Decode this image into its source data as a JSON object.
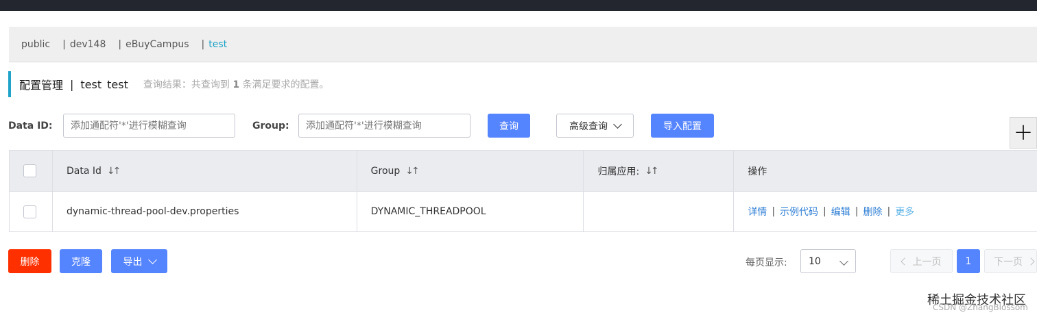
{
  "namespaces": {
    "items": [
      "public",
      "dev148",
      "eBuyCampus",
      "test"
    ],
    "separator": "|"
  },
  "header": {
    "title": "配置管理",
    "separator": "|",
    "namespace_name": "test",
    "namespace_id": "test",
    "result_prefix": "查询结果：共查询到",
    "result_count": "1",
    "result_suffix": "条满足要求的配置。"
  },
  "filters": {
    "data_id_label": "Data ID:",
    "data_id_placeholder": "添加通配符'*'进行模糊查询",
    "group_label": "Group:",
    "group_placeholder": "添加通配符'*'进行模糊查询",
    "query_button": "查询",
    "advanced_button": "高级查询",
    "import_button": "导入配置"
  },
  "plus_label": "+",
  "table": {
    "columns": {
      "data_id": "Data Id",
      "group": "Group",
      "app": "归属应用:",
      "ops": "操作"
    },
    "sort_icon": "↓↑",
    "rows": [
      {
        "data_id": "dynamic-thread-pool-dev.properties",
        "group": "DYNAMIC_THREADPOOL",
        "app": ""
      }
    ],
    "ops": {
      "detail": "详情",
      "sample": "示例代码",
      "edit": "编辑",
      "delete": "删除",
      "more": "更多",
      "separator": "|"
    }
  },
  "footer": {
    "delete_button": "删除",
    "clone_button": "克隆",
    "export_button": "导出",
    "page_size_label": "每页显示:",
    "page_size_value": "10",
    "prev_page": "上一页",
    "current_page": "1",
    "next_page": "下一页"
  },
  "watermark": {
    "main": "稀土掘金技术社区",
    "sub": "CSDN @ZhangBlossom"
  },
  "colors": {
    "primary": "#5584ff",
    "danger": "#ff3000",
    "accent": "#1fa3c8",
    "link": "#2e7ed5"
  }
}
